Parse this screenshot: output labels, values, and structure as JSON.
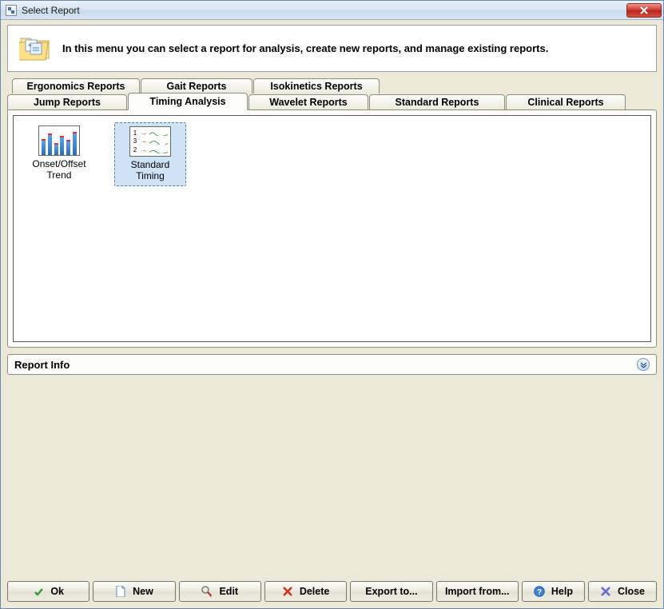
{
  "window": {
    "title": "Select Report"
  },
  "header": {
    "description": "In this menu you can select a report for analysis, create new reports, and manage existing reports."
  },
  "tabs": {
    "back_row": [
      "Ergonomics Reports",
      "Gait Reports",
      "Isokinetics Reports"
    ],
    "front_row": [
      "Jump Reports",
      "Timing Analysis",
      "Wavelet Reports",
      "Standard Reports",
      "Clinical Reports"
    ],
    "active": "Timing Analysis"
  },
  "reports": [
    {
      "label": "Onset/Offset Trend",
      "selected": false,
      "kind": "bars"
    },
    {
      "label": "Standard Timing",
      "selected": true,
      "kind": "timing"
    }
  ],
  "section": {
    "title": "Report Info"
  },
  "buttons": {
    "ok": "Ok",
    "new": "New",
    "edit": "Edit",
    "delete": "Delete",
    "export": "Export to...",
    "import": "Import from...",
    "help": "Help",
    "close": "Close"
  }
}
